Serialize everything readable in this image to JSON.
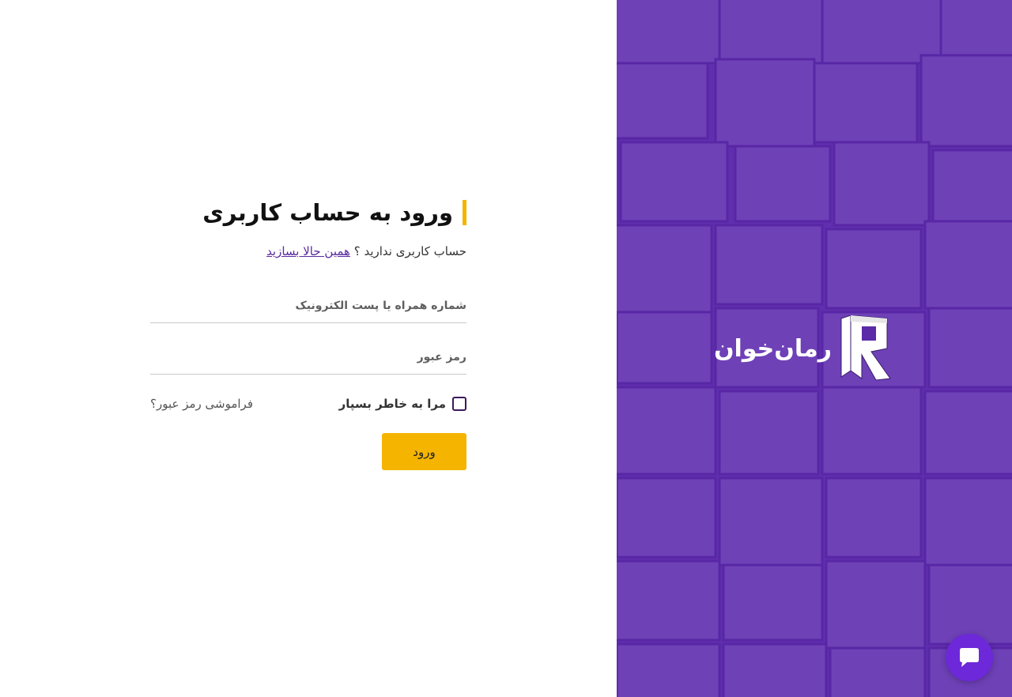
{
  "login": {
    "title": "ورود به حساب کاربری",
    "signup_prompt": "حساب کاربری ندارید ؟ ",
    "signup_link": "همین حالا بسازید",
    "phone_email_placeholder": "شماره همراه یا پست الکترونیک",
    "password_placeholder": "رمز عبور",
    "remember_label": "مرا به خاطر بسپار",
    "remember_checked": false,
    "forgot_link": "فراموشی رمز عبور؟",
    "submit_label": "ورود"
  },
  "brand": {
    "logo_text": "رمان‌خوان",
    "logo_icon": "r-book-logo-icon"
  },
  "chat": {
    "icon": "chat-bubble-icon"
  },
  "colors": {
    "accent": "#f5b400",
    "brand_purple": "#5a2aa8",
    "chat_purple": "#6d28d9",
    "link_purple": "#5a2aa0"
  }
}
